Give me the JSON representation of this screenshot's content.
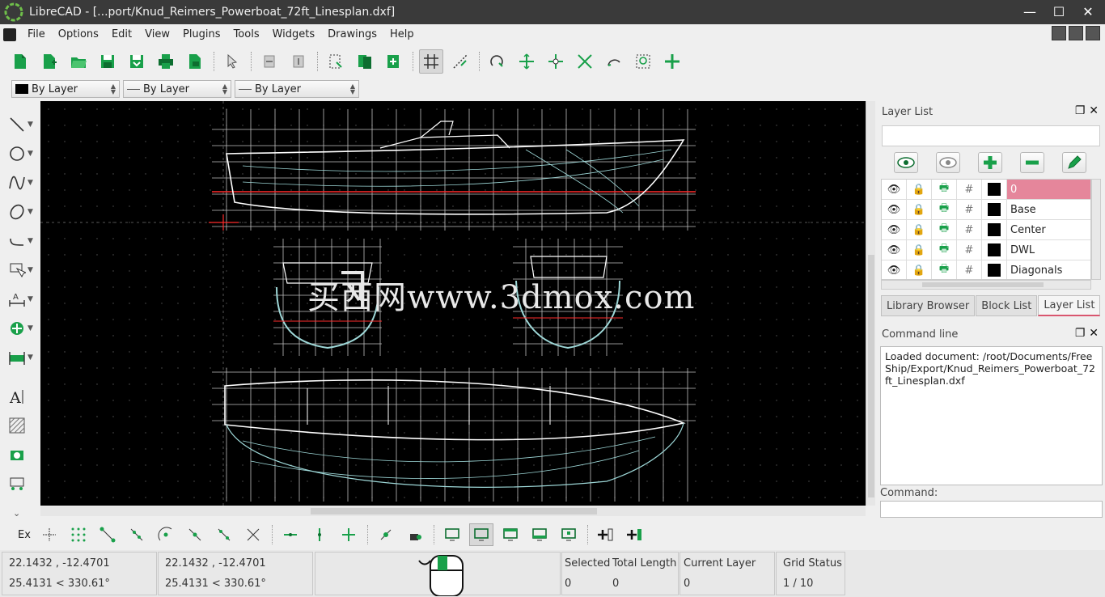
{
  "window": {
    "title": "LibreCAD - [...port/Knud_Reimers_Powerboat_72ft_Linesplan.dxf]"
  },
  "menu": [
    "File",
    "Options",
    "Edit",
    "View",
    "Plugins",
    "Tools",
    "Widgets",
    "Drawings",
    "Help"
  ],
  "pen": {
    "color": "By Layer",
    "width": "By Layer",
    "linetype": "By Layer"
  },
  "canvas": {
    "watermark": "买西网www.3dmox.com"
  },
  "layers": {
    "title": "Layer List",
    "rows": [
      {
        "name": "0",
        "selected": true
      },
      {
        "name": "Base",
        "selected": false
      },
      {
        "name": "Center",
        "selected": false
      },
      {
        "name": "DWL",
        "selected": false
      },
      {
        "name": "Diagonals",
        "selected": false
      }
    ]
  },
  "tabs": [
    "Library Browser",
    "Block List",
    "Layer List"
  ],
  "command": {
    "title": "Command line",
    "output": "Loaded document: /root/Documents/FreeShip/Export/Knud_Reimers_Powerboat_72ft_Linesplan.dxf",
    "label": "Command:"
  },
  "snap": {
    "ex_label": "Ex"
  },
  "status": {
    "abs_coord": "22.1432 , -12.4701",
    "abs_polar": "25.4131 < 330.61°",
    "rel_coord": "22.1432 , -12.4701",
    "rel_polar": "25.4131 < 330.61°",
    "selected_label": "Selected",
    "selected_value": "0",
    "total_length_label": "Total Length",
    "total_length_value": "0",
    "current_layer_label": "Current Layer",
    "current_layer_value": "0",
    "grid_status_label": "Grid Status",
    "grid_status_value": "1 / 10"
  },
  "colors": {
    "accent_green": "#19a04a",
    "selected_layer": "#e5869b",
    "canvas": "#000000"
  }
}
